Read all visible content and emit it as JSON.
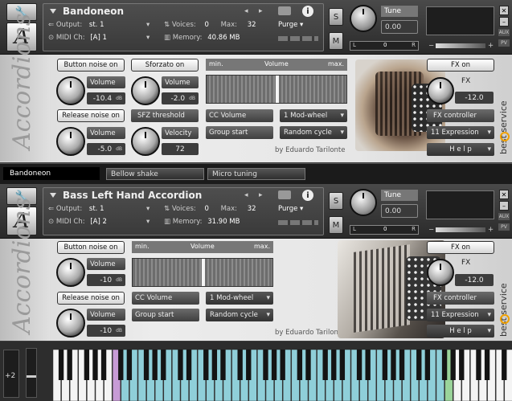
{
  "instruments": [
    {
      "name": "Bandoneon",
      "output_label": "Output:",
      "output": "st. 1",
      "voices_label": "Voices:",
      "voices": "0",
      "max_label": "Max:",
      "max": "32",
      "purge": "Purge",
      "midi_label": "MIDI Ch:",
      "midi": "[A]  1",
      "memory_label": "Memory:",
      "memory": "40.86 MB",
      "s_label": "S",
      "m_label": "M",
      "tune_label": "Tune",
      "tune": "0.00",
      "pan_l": "L",
      "pan_c": "0",
      "pan_r": "R",
      "aux": "AUX",
      "pv": "PV",
      "minus": "−",
      "plus": "+",
      "button_noise": "Button noise on",
      "sforzato": "Sforzato on",
      "vol1_label": "Volume",
      "vol1": "-10.4",
      "vol2_label": "Volume",
      "vol2": "-2.0",
      "release_noise": "Release noise on",
      "sfz_threshold": "SFZ threshold",
      "vol3_label": "Volume",
      "vol3": "-5.0",
      "velocity_label": "Velocity",
      "velocity": "72",
      "db": "dB",
      "meter_min": "min.",
      "meter_title": "Volume",
      "meter_max": "max.",
      "cc_volume": "CC Volume",
      "cc_value": "1 Mod-wheel",
      "group_start": "Group start",
      "group_value": "Random cycle",
      "by": "by Eduardo Tarilonte",
      "fx_on": "FX on",
      "fx_label": "FX",
      "fx_value": "-12.0",
      "fx_controller": "FX controller",
      "fx_expr": "11 Expression",
      "help": "H e l p",
      "brand": "best service",
      "script": "Accordions",
      "tabs": [
        "Bandoneon",
        "Bellow shake",
        "Micro tuning"
      ]
    },
    {
      "name": "Bass Left Hand Accordion",
      "output_label": "Output:",
      "output": "st. 1",
      "voices_label": "Voices:",
      "voices": "0",
      "max_label": "Max:",
      "max": "32",
      "purge": "Purge",
      "midi_label": "MIDI Ch:",
      "midi": "[A]  2",
      "memory_label": "Memory:",
      "memory": "31.90 MB",
      "s_label": "S",
      "m_label": "M",
      "tune_label": "Tune",
      "tune": "0.00",
      "pan_l": "L",
      "pan_c": "0",
      "pan_r": "R",
      "aux": "AUX",
      "pv": "PV",
      "minus": "−",
      "plus": "+",
      "button_noise": "Button noise on",
      "vol1_label": "Volume",
      "vol1": "-10",
      "release_noise": "Release noise on",
      "vol3_label": "Volume",
      "vol3": "-10",
      "db": "dB",
      "meter_min": "min.",
      "meter_title": "Volume",
      "meter_max": "max.",
      "cc_volume": "CC Volume",
      "cc_value": "1 Mod-wheel",
      "group_start": "Group start",
      "group_value": "Random cycle",
      "by": "by Eduardo Tarilonte",
      "fx_on": "FX on",
      "fx_label": "FX",
      "fx_value": "-12.0",
      "fx_controller": "FX controller",
      "fx_expr": "11 Expression",
      "help": "H e l p",
      "brand": "best service",
      "script": "Accordions"
    }
  ],
  "keyboard": {
    "octave": "+2"
  },
  "colors": {
    "accent": "#f0a000",
    "keys_active": "#8fcfd9",
    "key_marker_left": "#c79bd6",
    "key_marker_right": "#9ad49a"
  }
}
